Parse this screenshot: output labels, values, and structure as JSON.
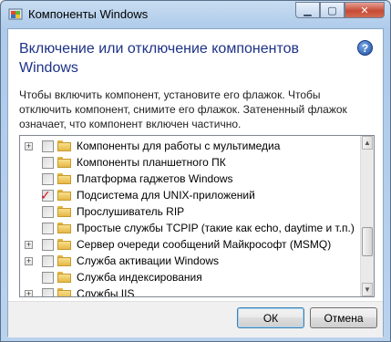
{
  "window": {
    "title": "Компоненты Windows",
    "caption_buttons": [
      "minimize",
      "maximize",
      "close"
    ]
  },
  "header": {
    "heading": "Включение или отключение компонентов Windows",
    "help_icon": "question-icon"
  },
  "description": "Чтобы включить компонент, установите его флажок. Чтобы отключить компонент, снимите его флажок. Затененный флажок означает, что компонент включен частично.",
  "features": [
    {
      "label": "Компоненты для работы с мультимедиа",
      "expandable": true,
      "checked": false
    },
    {
      "label": "Компоненты планшетного ПК",
      "expandable": false,
      "checked": false
    },
    {
      "label": "Платформа гаджетов Windows",
      "expandable": false,
      "checked": false
    },
    {
      "label": "Подсистема для UNIX-приложений",
      "expandable": false,
      "checked": true
    },
    {
      "label": "Прослушиватель RIP",
      "expandable": false,
      "checked": false
    },
    {
      "label": "Простые службы TCPIP (такие как echo, daytime и т.п.)",
      "expandable": false,
      "checked": false
    },
    {
      "label": "Сервер очереди сообщений Майкрософт (MSMQ)",
      "expandable": true,
      "checked": false
    },
    {
      "label": "Служба активации Windows",
      "expandable": true,
      "checked": false
    },
    {
      "label": "Служба индексирования",
      "expandable": false,
      "checked": false
    },
    {
      "label": "Службы IIS",
      "expandable": true,
      "checked": false
    }
  ],
  "buttons": {
    "ok": "ОК",
    "cancel": "Отмена"
  },
  "colors": {
    "heading": "#1e3287",
    "check_mark": "#d4141b"
  }
}
